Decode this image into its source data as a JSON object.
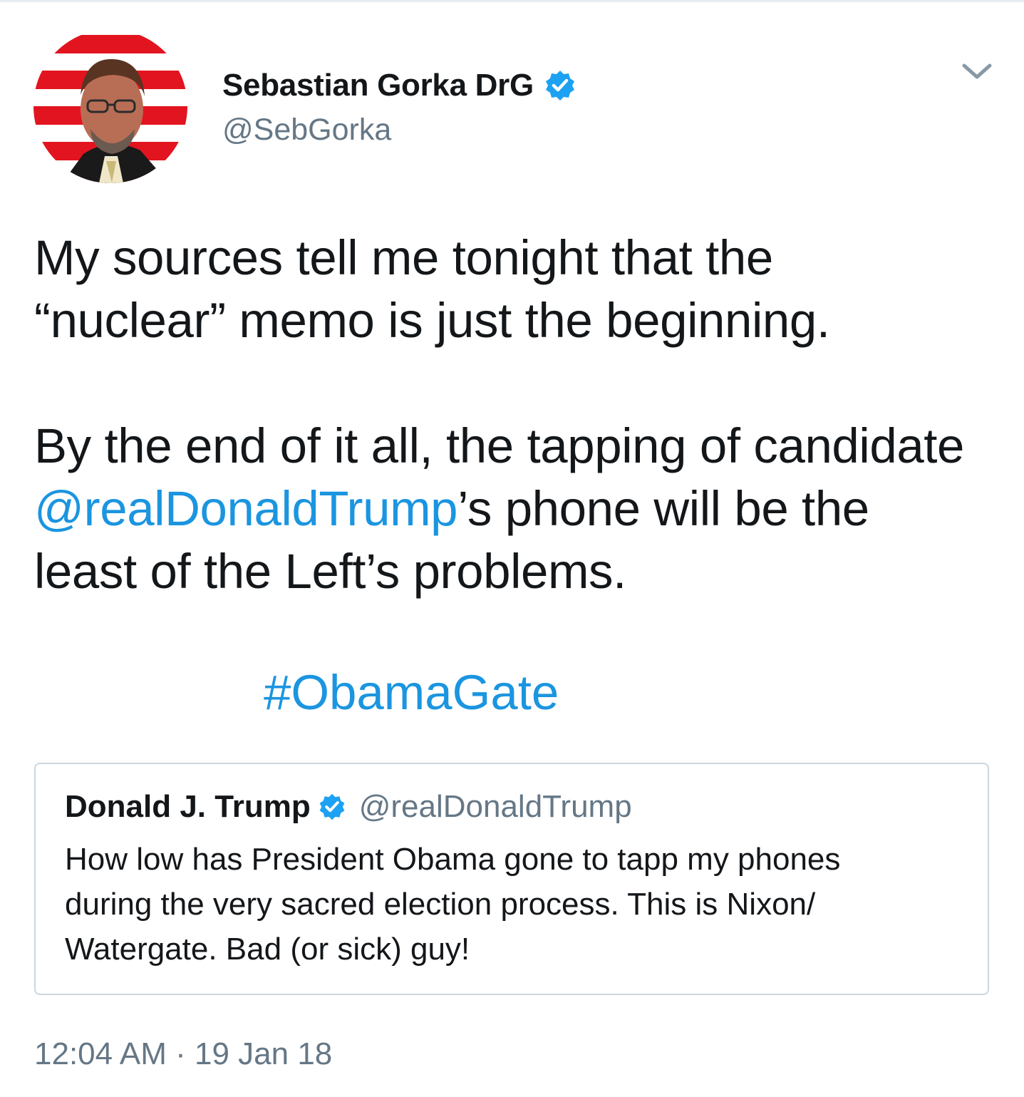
{
  "tweet": {
    "author": {
      "display_name": "Sebastian Gorka DrG",
      "handle": "@SebGorka",
      "verified": true,
      "avatar_icon": "profile-photo"
    },
    "menu_icon": "chevron-down-icon",
    "text_lines": [
      "My sources tell me tonight that the",
      "“nuclear” memo is just the beginning."
    ],
    "text_lines_2": {
      "line1": "By the end of it all, the tapping of candidate",
      "mention": "@realDonaldTrump",
      "line2_rest": "’s phone will be the",
      "line3": "least of the Left’s problems."
    },
    "hashtag": "#ObamaGate",
    "timestamp": "12:04 AM · 19 Jan 18"
  },
  "quoted_tweet": {
    "display_name": "Donald J. Trump",
    "handle": "@realDonaldTrump",
    "verified": true,
    "text_lines": [
      "How low has President Obama gone to tapp my phones",
      "during the very sacred election process. This is Nixon/",
      "Watergate. Bad (or sick) guy!"
    ]
  },
  "colors": {
    "link": "#1b95e0",
    "verified_badge": "#1da1f2",
    "secondary_text": "#657786",
    "border": "#ccd6dd"
  }
}
